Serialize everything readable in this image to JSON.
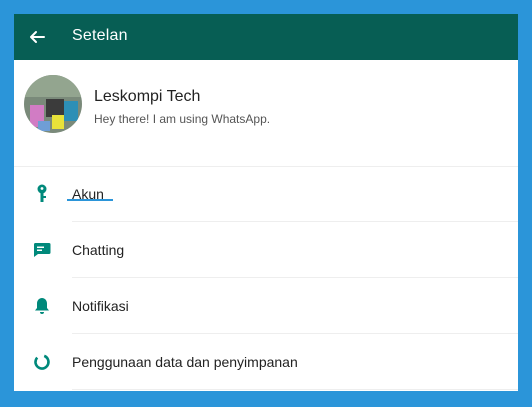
{
  "colors": {
    "toolbar": "#075e54",
    "accent": "#00897b",
    "background": "#2b95d9"
  },
  "appbar": {
    "title": "Setelan",
    "back_icon": "arrow-left-icon"
  },
  "profile": {
    "name": "Leskompi Tech",
    "status": "Hey there! I am using WhatsApp."
  },
  "items": [
    {
      "label": "Akun",
      "icon": "key-icon"
    },
    {
      "label": "Chatting",
      "icon": "chat-icon"
    },
    {
      "label": "Notifikasi",
      "icon": "bell-icon"
    },
    {
      "label": "Penggunaan data dan penyimpanan",
      "icon": "data-usage-icon"
    }
  ]
}
